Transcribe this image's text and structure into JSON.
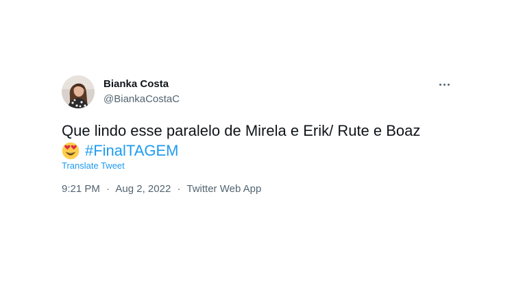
{
  "author": {
    "name": "Bianka Costa",
    "handle": "@BiankaCostaC"
  },
  "tweet": {
    "text_line1": "Que lindo esse paralelo de Mirela e Erik/ Rute e Boaz",
    "emoji": "heart-eyes-emoji",
    "hashtag": "#FinalTAGEM",
    "translate_label": "Translate Tweet",
    "time": "9:21 PM",
    "separator": "·",
    "date": "Aug 2, 2022",
    "source": "Twitter Web App"
  },
  "icons": {
    "more": "more-horizontal-icon",
    "avatar": "profile-photo"
  },
  "colors": {
    "link": "#1d9bf0",
    "text": "#0f1419",
    "secondary": "#536471",
    "background": "#ffffff"
  }
}
